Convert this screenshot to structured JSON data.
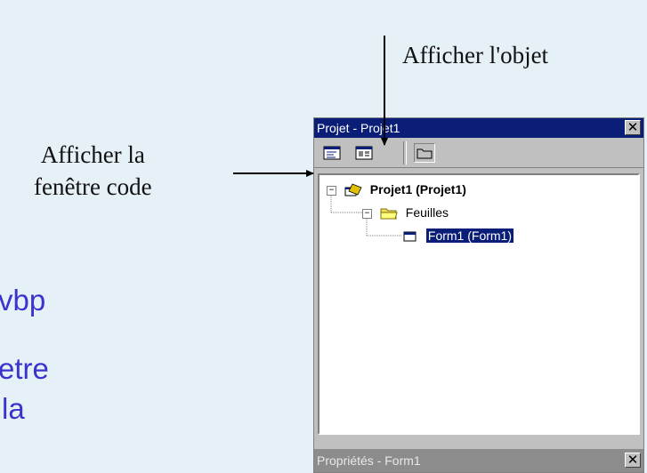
{
  "annotations": {
    "view_object": "Afficher l'objet",
    "view_code_line1": "Afficher la",
    "view_code_line2": "fenêtre code"
  },
  "background_text": {
    "line1": "vbp",
    "line2": "etre",
    "line3": "la"
  },
  "project_window": {
    "title": "Projet - Projet1",
    "close_glyph": "✕",
    "toolbar": {
      "view_code_icon": "view-code-icon",
      "view_object_icon": "view-object-icon",
      "toggle_folders_icon": "folder-icon"
    },
    "tree": {
      "project_label": "Projet1 (Projet1)",
      "folder_label": "Feuilles",
      "form_label": "Form1 (Form1)"
    },
    "properties_bar": {
      "title": "Propriétés - Form1",
      "close_glyph": "✕"
    }
  },
  "colors": {
    "title_bar": "#0a1e78",
    "window_face": "#c0c0c0",
    "slide_text": "#3b33cc",
    "background": "#e6f0f7"
  }
}
